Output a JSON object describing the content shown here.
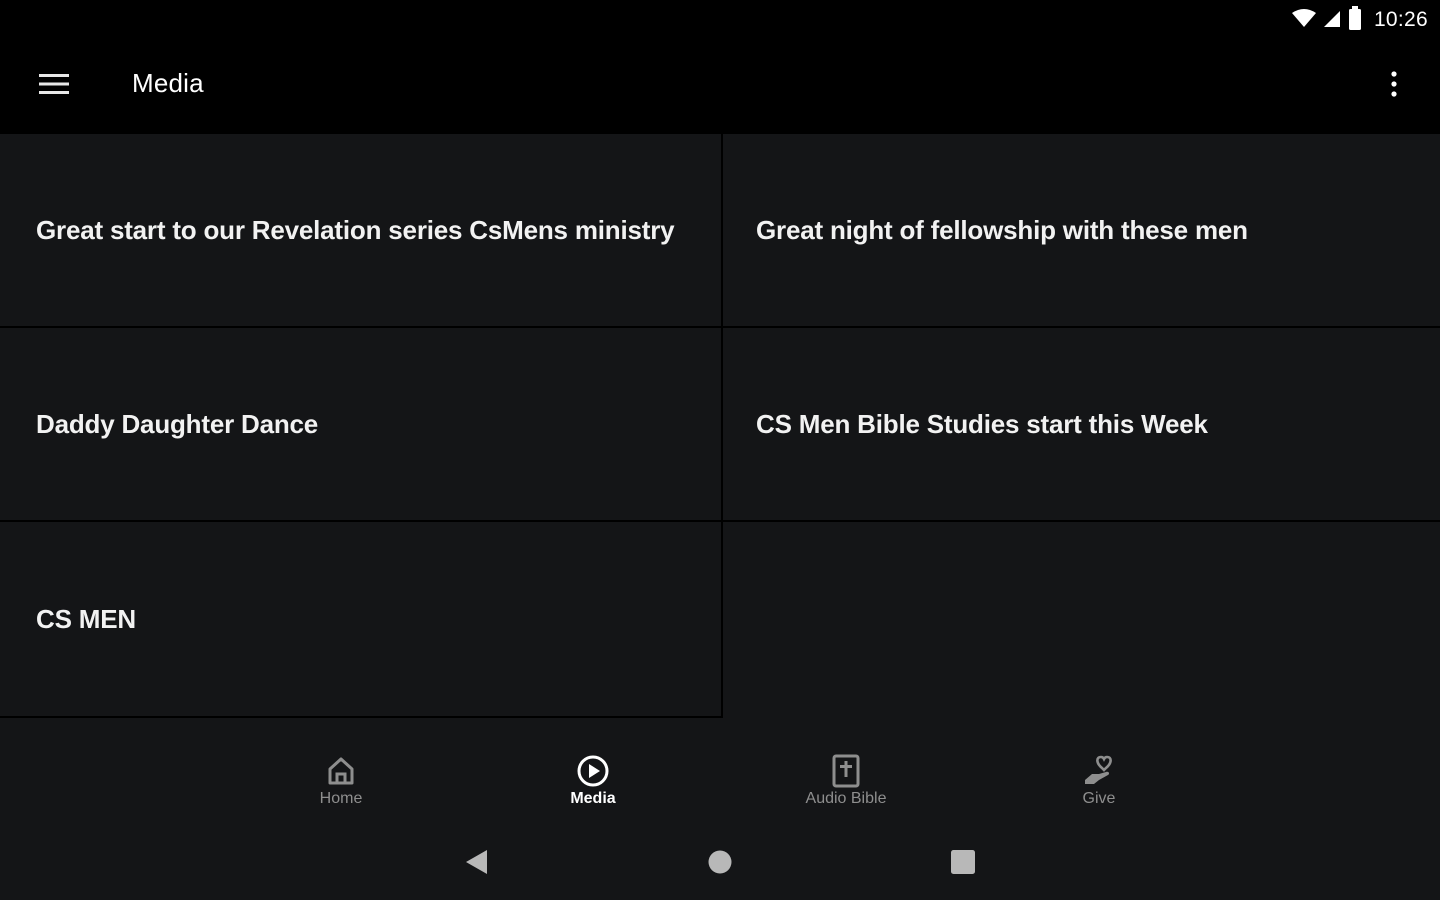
{
  "status_bar": {
    "time": "10:26",
    "icons": [
      "wifi-icon",
      "cell-signal-icon",
      "battery-icon"
    ]
  },
  "app_bar": {
    "title": "Media",
    "menu_icon": "hamburger-menu-icon",
    "overflow_icon": "more-vert-icon"
  },
  "media_items": [
    {
      "title": "Great start to our Revelation series CsMens ministry"
    },
    {
      "title": "Great night of fellowship with these men"
    },
    {
      "title": "Daddy Daughter Dance"
    },
    {
      "title": "CS Men Bible Studies start this Week"
    },
    {
      "title": "CS MEN"
    }
  ],
  "bottom_nav": {
    "items": [
      {
        "label": "Home",
        "icon": "home-icon",
        "active": false
      },
      {
        "label": "Media",
        "icon": "play-circle-icon",
        "active": true
      },
      {
        "label": "Audio Bible",
        "icon": "bible-icon",
        "active": false
      },
      {
        "label": "Give",
        "icon": "give-hand-heart-icon",
        "active": false
      }
    ]
  },
  "system_nav": {
    "icons": [
      "back-triangle-icon",
      "home-circle-icon",
      "recents-square-icon"
    ]
  },
  "colors": {
    "background": "#000000",
    "card": "#141517",
    "text": "#f2f2f2",
    "nav_inactive": "#8e8e8e",
    "nav_active": "#ffffff"
  }
}
